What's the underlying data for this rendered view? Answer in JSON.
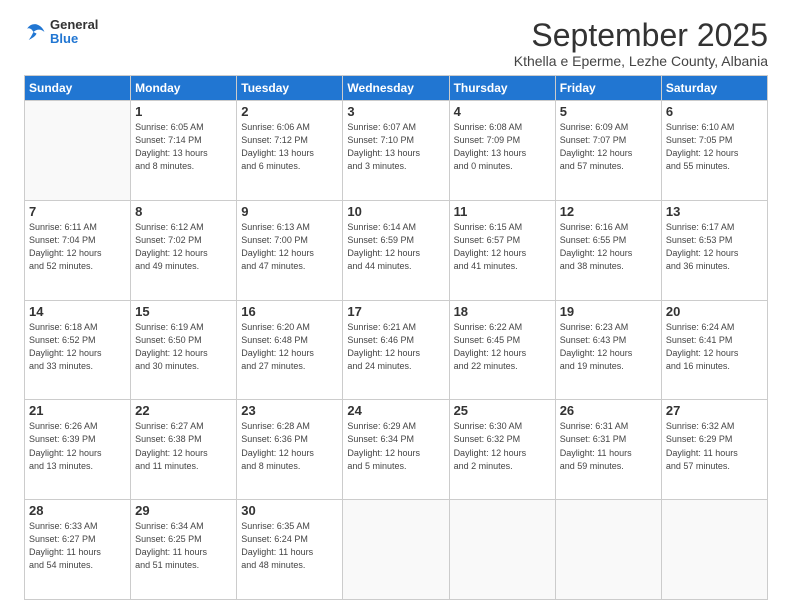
{
  "logo": {
    "general": "General",
    "blue": "Blue"
  },
  "header": {
    "month_title": "September 2025",
    "subtitle": "Kthella e Eperme, Lezhe County, Albania"
  },
  "weekdays": [
    "Sunday",
    "Monday",
    "Tuesday",
    "Wednesday",
    "Thursday",
    "Friday",
    "Saturday"
  ],
  "weeks": [
    [
      {
        "day": "",
        "detail": ""
      },
      {
        "day": "1",
        "detail": "Sunrise: 6:05 AM\nSunset: 7:14 PM\nDaylight: 13 hours\nand 8 minutes."
      },
      {
        "day": "2",
        "detail": "Sunrise: 6:06 AM\nSunset: 7:12 PM\nDaylight: 13 hours\nand 6 minutes."
      },
      {
        "day": "3",
        "detail": "Sunrise: 6:07 AM\nSunset: 7:10 PM\nDaylight: 13 hours\nand 3 minutes."
      },
      {
        "day": "4",
        "detail": "Sunrise: 6:08 AM\nSunset: 7:09 PM\nDaylight: 13 hours\nand 0 minutes."
      },
      {
        "day": "5",
        "detail": "Sunrise: 6:09 AM\nSunset: 7:07 PM\nDaylight: 12 hours\nand 57 minutes."
      },
      {
        "day": "6",
        "detail": "Sunrise: 6:10 AM\nSunset: 7:05 PM\nDaylight: 12 hours\nand 55 minutes."
      }
    ],
    [
      {
        "day": "7",
        "detail": "Sunrise: 6:11 AM\nSunset: 7:04 PM\nDaylight: 12 hours\nand 52 minutes."
      },
      {
        "day": "8",
        "detail": "Sunrise: 6:12 AM\nSunset: 7:02 PM\nDaylight: 12 hours\nand 49 minutes."
      },
      {
        "day": "9",
        "detail": "Sunrise: 6:13 AM\nSunset: 7:00 PM\nDaylight: 12 hours\nand 47 minutes."
      },
      {
        "day": "10",
        "detail": "Sunrise: 6:14 AM\nSunset: 6:59 PM\nDaylight: 12 hours\nand 44 minutes."
      },
      {
        "day": "11",
        "detail": "Sunrise: 6:15 AM\nSunset: 6:57 PM\nDaylight: 12 hours\nand 41 minutes."
      },
      {
        "day": "12",
        "detail": "Sunrise: 6:16 AM\nSunset: 6:55 PM\nDaylight: 12 hours\nand 38 minutes."
      },
      {
        "day": "13",
        "detail": "Sunrise: 6:17 AM\nSunset: 6:53 PM\nDaylight: 12 hours\nand 36 minutes."
      }
    ],
    [
      {
        "day": "14",
        "detail": "Sunrise: 6:18 AM\nSunset: 6:52 PM\nDaylight: 12 hours\nand 33 minutes."
      },
      {
        "day": "15",
        "detail": "Sunrise: 6:19 AM\nSunset: 6:50 PM\nDaylight: 12 hours\nand 30 minutes."
      },
      {
        "day": "16",
        "detail": "Sunrise: 6:20 AM\nSunset: 6:48 PM\nDaylight: 12 hours\nand 27 minutes."
      },
      {
        "day": "17",
        "detail": "Sunrise: 6:21 AM\nSunset: 6:46 PM\nDaylight: 12 hours\nand 24 minutes."
      },
      {
        "day": "18",
        "detail": "Sunrise: 6:22 AM\nSunset: 6:45 PM\nDaylight: 12 hours\nand 22 minutes."
      },
      {
        "day": "19",
        "detail": "Sunrise: 6:23 AM\nSunset: 6:43 PM\nDaylight: 12 hours\nand 19 minutes."
      },
      {
        "day": "20",
        "detail": "Sunrise: 6:24 AM\nSunset: 6:41 PM\nDaylight: 12 hours\nand 16 minutes."
      }
    ],
    [
      {
        "day": "21",
        "detail": "Sunrise: 6:26 AM\nSunset: 6:39 PM\nDaylight: 12 hours\nand 13 minutes."
      },
      {
        "day": "22",
        "detail": "Sunrise: 6:27 AM\nSunset: 6:38 PM\nDaylight: 12 hours\nand 11 minutes."
      },
      {
        "day": "23",
        "detail": "Sunrise: 6:28 AM\nSunset: 6:36 PM\nDaylight: 12 hours\nand 8 minutes."
      },
      {
        "day": "24",
        "detail": "Sunrise: 6:29 AM\nSunset: 6:34 PM\nDaylight: 12 hours\nand 5 minutes."
      },
      {
        "day": "25",
        "detail": "Sunrise: 6:30 AM\nSunset: 6:32 PM\nDaylight: 12 hours\nand 2 minutes."
      },
      {
        "day": "26",
        "detail": "Sunrise: 6:31 AM\nSunset: 6:31 PM\nDaylight: 11 hours\nand 59 minutes."
      },
      {
        "day": "27",
        "detail": "Sunrise: 6:32 AM\nSunset: 6:29 PM\nDaylight: 11 hours\nand 57 minutes."
      }
    ],
    [
      {
        "day": "28",
        "detail": "Sunrise: 6:33 AM\nSunset: 6:27 PM\nDaylight: 11 hours\nand 54 minutes."
      },
      {
        "day": "29",
        "detail": "Sunrise: 6:34 AM\nSunset: 6:25 PM\nDaylight: 11 hours\nand 51 minutes."
      },
      {
        "day": "30",
        "detail": "Sunrise: 6:35 AM\nSunset: 6:24 PM\nDaylight: 11 hours\nand 48 minutes."
      },
      {
        "day": "",
        "detail": ""
      },
      {
        "day": "",
        "detail": ""
      },
      {
        "day": "",
        "detail": ""
      },
      {
        "day": "",
        "detail": ""
      }
    ]
  ]
}
